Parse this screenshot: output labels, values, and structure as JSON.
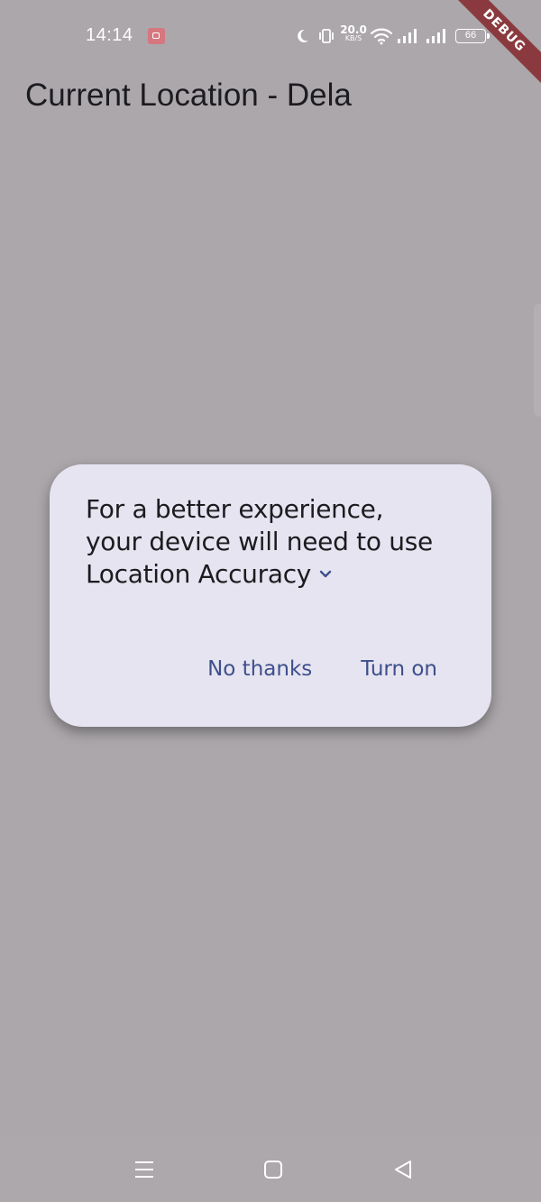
{
  "status_bar": {
    "time": "14:14",
    "net_speed_value": "20.0",
    "net_speed_unit": "KB/S",
    "battery_level": "66",
    "icons": [
      "screen-record-icon",
      "moon-icon",
      "vibrate-icon",
      "wifi-icon",
      "signal-icon",
      "signal-icon",
      "battery-icon"
    ]
  },
  "debug_banner": "DEBUG",
  "app_bar": {
    "title": "Current Location - Dela"
  },
  "dialog": {
    "message_lines": [
      "For a better experience,",
      "your device will need to use",
      "Location Accuracy"
    ],
    "expand_icon": "chevron-down-icon",
    "buttons": {
      "no_thanks": "No thanks",
      "turn_on": "Turn on"
    }
  },
  "nav_bar": {
    "icons": [
      "menu-icon",
      "home-square-icon",
      "back-triangle-icon"
    ]
  },
  "colors": {
    "scrim_background": "#aba7ab",
    "dialog_background": "#e6e4f0",
    "button_text": "#3e4f8d",
    "debug_ribbon": "#8a3a3e",
    "text_primary": "#1c1b1f"
  }
}
